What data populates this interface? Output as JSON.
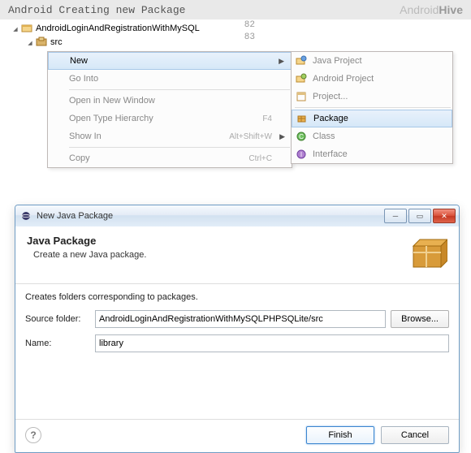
{
  "header": {
    "title": "Android Creating new Package",
    "brand_pre": "Android",
    "brand_post": "Hive"
  },
  "tree": {
    "project": "AndroidLoginAndRegistrationWithMySQL",
    "folder": "src"
  },
  "linenums": [
    "82",
    "83"
  ],
  "context_menu": {
    "new": "New",
    "go_into": "Go Into",
    "open_new_window": "Open in New Window",
    "open_type_hierarchy": "Open Type Hierarchy",
    "show_in": "Show In",
    "copy": "Copy",
    "shortcut_f4": "F4",
    "shortcut_showin": "Alt+Shift+W",
    "shortcut_copy": "Ctrl+C"
  },
  "submenu": {
    "java_project": "Java Project",
    "android_project": "Android Project",
    "project": "Project...",
    "package": "Package",
    "class": "Class",
    "interface": "Interface"
  },
  "dialog": {
    "window_title": "New Java Package",
    "heading": "Java Package",
    "subheading": "Create a new Java package.",
    "description": "Creates folders corresponding to packages.",
    "label_source": "Source folder:",
    "value_source": "AndroidLoginAndRegistrationWithMySQLPHPSQLite/src",
    "label_name": "Name:",
    "value_name": "library",
    "browse": "Browse...",
    "finish": "Finish",
    "cancel": "Cancel",
    "help": "?"
  }
}
